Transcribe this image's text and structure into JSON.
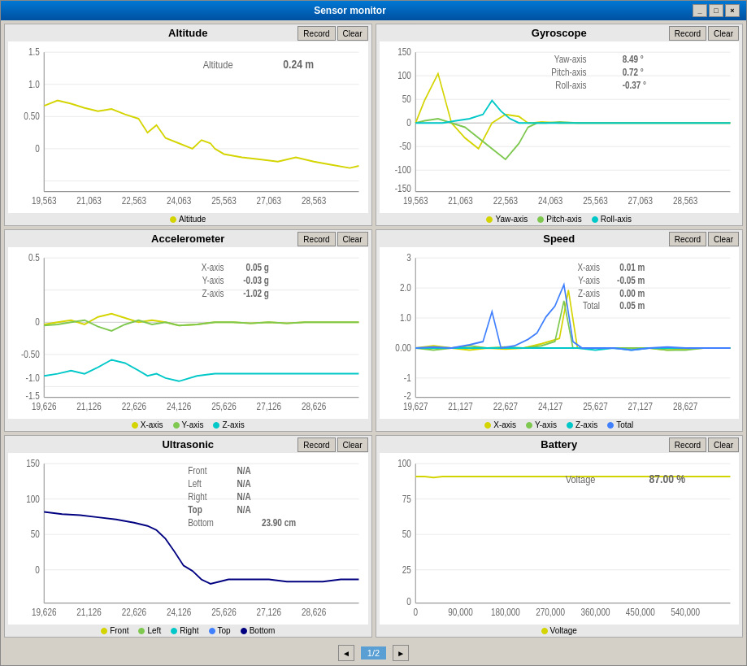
{
  "window": {
    "title": "Sensor monitor",
    "controls": [
      "_",
      "□",
      "×"
    ]
  },
  "panels": {
    "altitude": {
      "title": "Altitude",
      "record_label": "Record",
      "clear_label": "Clear",
      "data": {
        "label": "Altitude",
        "value": "0.24",
        "unit": "m"
      },
      "legend": [
        {
          "label": "Altitude",
          "color": "#d4d400"
        }
      ],
      "x_axis": [
        "19,563",
        "21,063",
        "22,563",
        "24,063",
        "25,563",
        "27,063",
        "28,563"
      ],
      "y_axis": [
        "1.5",
        "1.0",
        "0.50",
        "0",
        ""
      ]
    },
    "gyroscope": {
      "title": "Gyroscope",
      "record_label": "Record",
      "clear_label": "Clear",
      "data": [
        {
          "label": "Yaw-axis",
          "value": "8.49",
          "unit": "°"
        },
        {
          "label": "Pitch-axis",
          "value": "0.72",
          "unit": "°"
        },
        {
          "label": "Roll-axis",
          "value": "-0.37",
          "unit": "°"
        }
      ],
      "legend": [
        {
          "label": "Yaw-axis",
          "color": "#d4d400"
        },
        {
          "label": "Pitch-axis",
          "color": "#7ec850"
        },
        {
          "label": "Roll-axis",
          "color": "#00c8c8"
        }
      ],
      "x_axis": [
        "19,563",
        "21,063",
        "22,563",
        "24,063",
        "25,563",
        "27,063",
        "28,563"
      ],
      "y_axis": [
        "150",
        "100",
        "50",
        "0",
        "-50",
        "-100",
        "-150"
      ]
    },
    "accelerometer": {
      "title": "Accelerometer",
      "record_label": "Record",
      "clear_label": "Clear",
      "data": [
        {
          "label": "X-axis",
          "value": "0.05",
          "unit": "g"
        },
        {
          "label": "Y-axis",
          "value": "-0.03",
          "unit": "g"
        },
        {
          "label": "Z-axis",
          "value": "-1.02",
          "unit": "g"
        }
      ],
      "legend": [
        {
          "label": "X-axis",
          "color": "#d4d400"
        },
        {
          "label": "Y-axis",
          "color": "#7ec850"
        },
        {
          "label": "Z-axis",
          "color": "#00c8c8"
        }
      ],
      "x_axis": [
        "19,626",
        "21,126",
        "22,626",
        "24,126",
        "25,626",
        "27,126",
        "28,626"
      ],
      "y_axis": [
        "0.5",
        "0",
        "-0.50",
        "-1.0",
        "-1.5"
      ]
    },
    "speed": {
      "title": "Speed",
      "record_label": "Record",
      "clear_label": "Clear",
      "data": [
        {
          "label": "X-axis",
          "value": "0.01",
          "unit": "m"
        },
        {
          "label": "Y-axis",
          "value": "-0.05",
          "unit": "m"
        },
        {
          "label": "Z-axis",
          "value": "0.00",
          "unit": "m"
        },
        {
          "label": "Total",
          "value": "0.05",
          "unit": "m"
        }
      ],
      "legend": [
        {
          "label": "X-axis",
          "color": "#d4d400"
        },
        {
          "label": "Y-axis",
          "color": "#7ec850"
        },
        {
          "label": "Z-axis",
          "color": "#00c8c8"
        },
        {
          "label": "Total",
          "color": "#4080ff"
        }
      ],
      "x_axis": [
        "19,627",
        "21,127",
        "22,627",
        "24,127",
        "25,627",
        "27,127",
        "28,627"
      ],
      "y_axis": [
        "3",
        "2.0",
        "1.0",
        "0.00",
        "-1",
        "-2"
      ]
    },
    "ultrasonic": {
      "title": "Ultrasonic",
      "record_label": "Record",
      "clear_label": "Clear",
      "data": [
        {
          "label": "Front",
          "value": "N/A",
          "unit": ""
        },
        {
          "label": "Left",
          "value": "N/A",
          "unit": ""
        },
        {
          "label": "Right",
          "value": "N/A",
          "unit": ""
        },
        {
          "label": "Top",
          "value": "N/A",
          "unit": ""
        },
        {
          "label": "Bottom",
          "value": "23.90",
          "unit": "cm"
        }
      ],
      "legend": [
        {
          "label": "Front",
          "color": "#d4d400"
        },
        {
          "label": "Left",
          "color": "#7ec850"
        },
        {
          "label": "Right",
          "color": "#00c8c8"
        },
        {
          "label": "Top",
          "color": "#4080ff"
        },
        {
          "label": "Bottom",
          "color": "#000080"
        }
      ],
      "x_axis": [
        "19,626",
        "21,126",
        "22,626",
        "24,126",
        "25,626",
        "27,126",
        "28,626"
      ],
      "y_axis": [
        "150",
        "100",
        "50",
        "0"
      ]
    },
    "battery": {
      "title": "Battery",
      "record_label": "Record",
      "clear_label": "Clear",
      "data": [
        {
          "label": "Voltage",
          "value": "87.00",
          "unit": "%"
        }
      ],
      "legend": [
        {
          "label": "Voltage",
          "color": "#d4d400"
        }
      ],
      "x_axis": [
        "0",
        "90,000",
        "180,000",
        "270,000",
        "360,000",
        "450,000",
        "540,000"
      ],
      "y_axis": [
        "100",
        "75",
        "50",
        "25",
        "0"
      ]
    }
  },
  "navigation": {
    "prev": "◄",
    "next": "►",
    "page": "1/2"
  }
}
